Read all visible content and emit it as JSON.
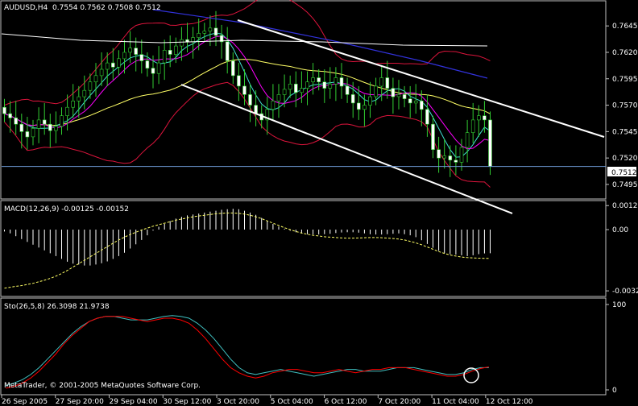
{
  "chart_data": [
    {
      "type": "candlestick",
      "panel": "price",
      "symbol_timeframe": "AUDUSD,H4",
      "ohlc_text": "0.7554 0.7562 0.7508 0.7512",
      "last_price_label": "0.7512",
      "ylim": [
        0.7482,
        0.7668
      ],
      "y_ticks": [
        "0.7645",
        "0.7620",
        "0.7595",
        "0.7570",
        "0.7545",
        "0.7520",
        "0.7495"
      ],
      "x_ticks": [
        "26 Sep 2005",
        "27 Sep 20:00",
        "29 Sep 04:00",
        "30 Sep 12:00",
        "3 Oct 20:00",
        "5 Oct 04:00",
        "6 Oct 12:00",
        "7 Oct 20:00",
        "11 Oct 04:00",
        "12 Oct 12:00"
      ],
      "close_path": [
        0.7562,
        0.7558,
        0.7552,
        0.7545,
        0.754,
        0.7548,
        0.7556,
        0.7552,
        0.7546,
        0.755,
        0.756,
        0.7568,
        0.7574,
        0.7578,
        0.7584,
        0.7592,
        0.7598,
        0.7604,
        0.761,
        0.7606,
        0.7614,
        0.762,
        0.7624,
        0.7618,
        0.7612,
        0.7605,
        0.76,
        0.761,
        0.7622,
        0.7618,
        0.7626,
        0.7632,
        0.763,
        0.7634,
        0.7638,
        0.764,
        0.7643,
        0.7636,
        0.763,
        0.7612,
        0.7598,
        0.7588,
        0.758,
        0.757,
        0.7562,
        0.7556,
        0.7566,
        0.7574,
        0.758,
        0.7585,
        0.759,
        0.7582,
        0.7586,
        0.7592,
        0.7596,
        0.7592,
        0.7586,
        0.759,
        0.7596,
        0.7588,
        0.758,
        0.7572,
        0.7566,
        0.757,
        0.7578,
        0.7588,
        0.7596,
        0.7586,
        0.7578,
        0.758,
        0.7576,
        0.7572,
        0.7574,
        0.7566,
        0.7552,
        0.7528,
        0.752,
        0.7522,
        0.7518,
        0.7516,
        0.753,
        0.7544,
        0.7556,
        0.756,
        0.7556,
        0.7512
      ]
    },
    {
      "type": "histogram",
      "panel": "macd",
      "label": "MACD(12,26,9) -0.00125 -0.00152",
      "y_ticks": [
        "0.00127",
        "0.00",
        "-0.00324"
      ],
      "ylim": [
        -0.00345,
        0.00145
      ],
      "hist": [
        -0.0001,
        -0.0002,
        -0.00035,
        -0.0005,
        -0.00065,
        -0.0008,
        -0.00095,
        -0.0011,
        -0.00125,
        -0.0014,
        -0.00155,
        -0.0017,
        -0.0018,
        -0.00185,
        -0.0019,
        -0.0019,
        -0.00185,
        -0.00178,
        -0.00168,
        -0.00155,
        -0.0014,
        -0.00122,
        -0.001,
        -0.00078,
        -0.00055,
        -0.0003,
        -5e-05,
        0.00015,
        0.0003,
        0.00045,
        0.00058,
        0.00068,
        0.00075,
        0.0008,
        0.00085,
        0.0009,
        0.00095,
        0.001,
        0.00105,
        0.00108,
        0.0011,
        0.00108,
        0.001,
        0.0009,
        0.00078,
        0.00062,
        0.00046,
        0.0003,
        0.00016,
        4e-05,
        -6e-05,
        -0.00014,
        -0.0002,
        -0.00024,
        -0.00026,
        -0.00026,
        -0.00024,
        -0.00022,
        -0.00018,
        -0.00015,
        -0.00014,
        -0.00014,
        -0.00016,
        -0.0002,
        -0.00024,
        -0.00026,
        -0.00026,
        -0.00024,
        -0.00022,
        -0.0002,
        -0.00024,
        -0.0003,
        -0.0004,
        -0.00056,
        -0.00076,
        -0.00096,
        -0.00112,
        -0.00124,
        -0.0013,
        -0.00132,
        -0.00136,
        -0.0014,
        -0.00136,
        -0.0013,
        -0.00126,
        -0.00125
      ],
      "signal": [
        -0.0031,
        -0.00305,
        -0.003,
        -0.00296,
        -0.0029,
        -0.00284,
        -0.00276,
        -0.00268,
        -0.00258,
        -0.00246,
        -0.00232,
        -0.00216,
        -0.00198,
        -0.0018,
        -0.00162,
        -0.00144,
        -0.00126,
        -0.00108,
        -0.0009,
        -0.00072,
        -0.00055,
        -0.0004,
        -0.00026,
        -0.00014,
        -2e-05,
        8e-05,
        0.00018,
        0.00026,
        0.00034,
        0.00042,
        0.0005,
        0.00056,
        0.00062,
        0.00068,
        0.00072,
        0.00076,
        0.0008,
        0.00084,
        0.00086,
        0.00088,
        0.00088,
        0.00086,
        0.00082,
        0.00076,
        0.00068,
        0.00058,
        0.00046,
        0.00034,
        0.00022,
        0.0001,
        0.0,
        -0.0001,
        -0.00018,
        -0.00024,
        -0.0003,
        -0.00034,
        -0.00038,
        -0.0004,
        -0.00042,
        -0.00044,
        -0.00045,
        -0.00045,
        -0.00044,
        -0.00043,
        -0.00042,
        -0.00042,
        -0.00043,
        -0.00045,
        -0.00047,
        -0.0005,
        -0.00055,
        -0.00062,
        -0.0007,
        -0.0008,
        -0.00092,
        -0.00104,
        -0.00116,
        -0.00126,
        -0.00134,
        -0.0014,
        -0.00145,
        -0.00148,
        -0.0015,
        -0.00151,
        -0.00152,
        -0.00152
      ]
    },
    {
      "type": "line",
      "panel": "stochastic",
      "label": "Sto(26,5,8) 26.3098 21.9738",
      "y_ticks": [
        "100",
        "0"
      ],
      "ylim": [
        0,
        100
      ],
      "series": [
        {
          "values": [
            5,
            8,
            12,
            18,
            26,
            36,
            46,
            56,
            66,
            74,
            80,
            84,
            86,
            86,
            84,
            82,
            82,
            82,
            84,
            86,
            87,
            86,
            84,
            78,
            70,
            60,
            48,
            36,
            26,
            20,
            18,
            20,
            22,
            24,
            22,
            20,
            18,
            16,
            18,
            20,
            22,
            24,
            24,
            22,
            22,
            22,
            24,
            26,
            26,
            26,
            24,
            22,
            20,
            18,
            18,
            20,
            24,
            26,
            26
          ]
        },
        {
          "values": [
            2,
            4,
            8,
            14,
            22,
            32,
            42,
            54,
            64,
            72,
            80,
            84,
            86,
            86,
            86,
            84,
            82,
            80,
            82,
            84,
            84,
            82,
            78,
            70,
            60,
            48,
            36,
            26,
            20,
            16,
            14,
            16,
            20,
            22,
            24,
            24,
            22,
            20,
            20,
            22,
            24,
            22,
            20,
            22,
            24,
            24,
            26,
            26,
            26,
            24,
            22,
            20,
            18,
            16,
            16,
            18,
            22,
            25,
            27
          ]
        }
      ]
    }
  ],
  "watermark": "MetaTrader, © 2001-2005 MetaQuotes Software Corp.",
  "colors": {
    "bull": "#32cd32",
    "bear": "#ffffff",
    "bollinger": "#dc143c",
    "ma_blue": "#3232dc",
    "ma_white": "#ffffff",
    "ma_yellow": "#ffff66",
    "ma_cyan": "#40e0d0",
    "ma_magenta": "#ff00ff",
    "grid": "#1a1a1a",
    "border": "#c0c0c0",
    "last_line": "#6f9bd8",
    "sto_main": "#40c0c0",
    "sto_signal": "#ff0000"
  }
}
